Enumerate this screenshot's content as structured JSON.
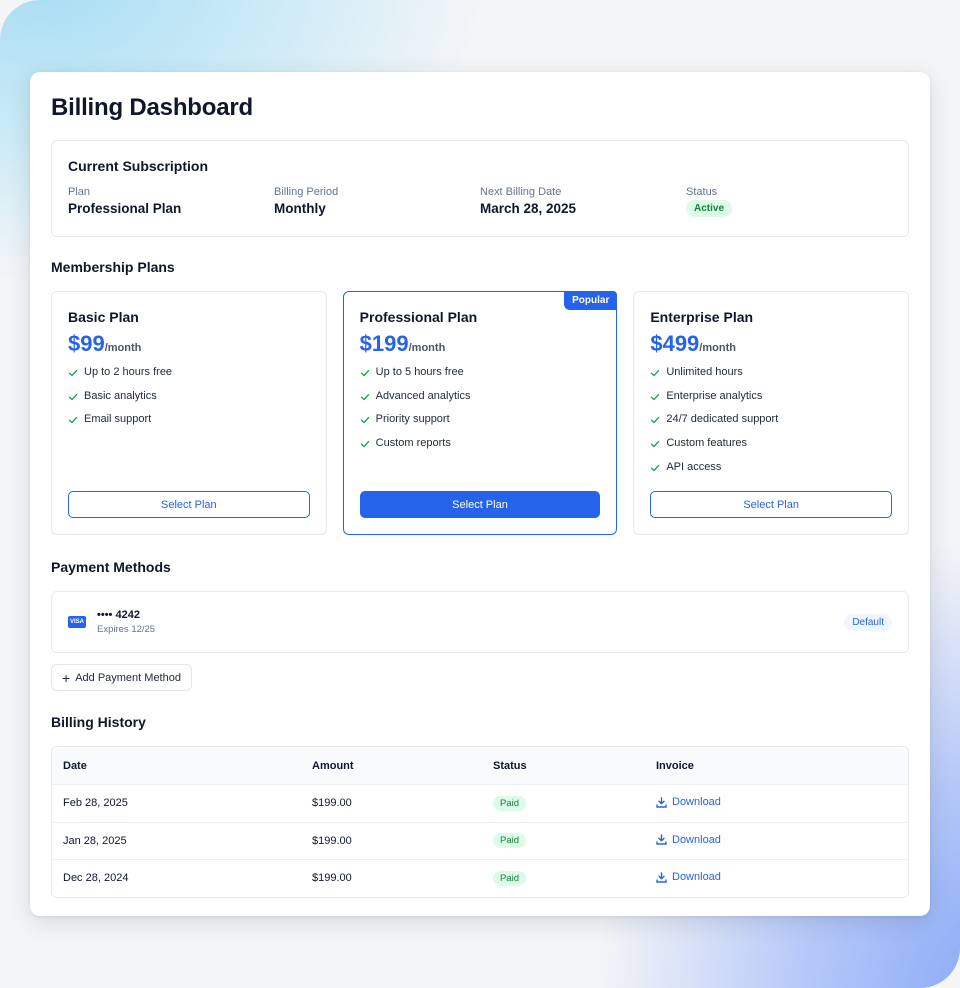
{
  "page": {
    "title": "Billing Dashboard"
  },
  "subscription": {
    "title": "Current Subscription",
    "fields": [
      {
        "label": "Plan",
        "value": "Professional Plan"
      },
      {
        "label": "Billing Period",
        "value": "Monthly"
      },
      {
        "label": "Next Billing Date",
        "value": "March 28, 2025"
      }
    ],
    "status_label": "Status",
    "status_value": "Active"
  },
  "plans": {
    "title": "Membership Plans",
    "popular_label": "Popular",
    "items": [
      {
        "name": "Basic Plan",
        "price": "$99",
        "period": "/month",
        "features": [
          "Up to 2 hours free",
          "Basic analytics",
          "Email support"
        ],
        "button": "Select Plan"
      },
      {
        "name": "Professional Plan",
        "price": "$199",
        "period": "/month",
        "features": [
          "Up to 5 hours free",
          "Advanced analytics",
          "Priority support",
          "Custom reports"
        ],
        "button": "Select Plan"
      },
      {
        "name": "Enterprise Plan",
        "price": "$499",
        "period": "/month",
        "features": [
          "Unlimited hours",
          "Enterprise analytics",
          "24/7 dedicated support",
          "Custom features",
          "API access"
        ],
        "button": "Select Plan"
      }
    ]
  },
  "payment": {
    "title": "Payment Methods",
    "card_brand": "VISA",
    "card_number": "•••• 4242",
    "card_expiry": "Expires 12/25",
    "default_label": "Default",
    "add_label": "Add Payment Method"
  },
  "history": {
    "title": "Billing History",
    "columns": [
      "Date",
      "Amount",
      "Status",
      "Invoice"
    ],
    "rows": [
      {
        "date": "Feb 28, 2025",
        "amount": "$199.00",
        "status": "Paid",
        "invoice": "Download"
      },
      {
        "date": "Jan 28, 2025",
        "amount": "$199.00",
        "status": "Paid",
        "invoice": "Download"
      },
      {
        "date": "Dec 28, 2024",
        "amount": "$199.00",
        "status": "Paid",
        "invoice": "Download"
      }
    ]
  },
  "colors": {
    "accent": "#2563eb",
    "success": "#16a34a",
    "success_bg": "#dcfce7"
  },
  "icons": {
    "feature": "check-icon",
    "add": "plus-icon",
    "invoice": "download-icon",
    "card": "visa-card-icon"
  }
}
